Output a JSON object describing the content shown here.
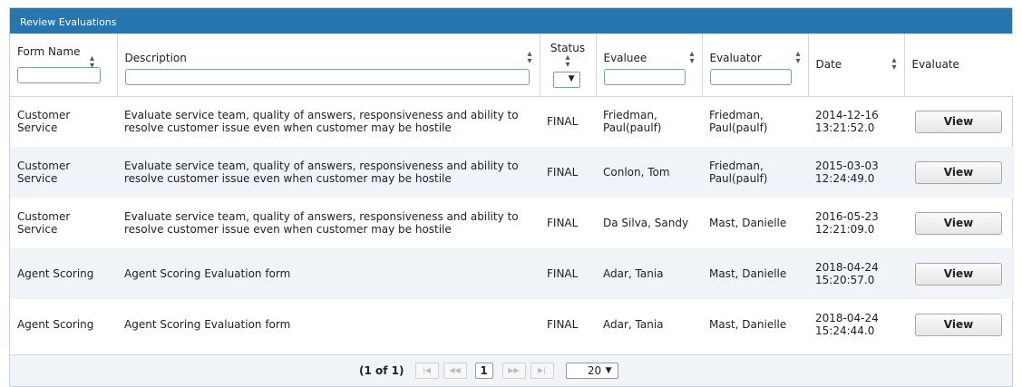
{
  "panel": {
    "title": "Review Evaluations"
  },
  "columns": {
    "form_name": "Form Name",
    "description": "Description",
    "status": "Status",
    "evaluee": "Evaluee",
    "evaluator": "Evaluator",
    "date": "Date",
    "evaluate": "Evaluate"
  },
  "icons": {
    "sort": "sort-up-down-icon",
    "dropdown": "caret-down-icon"
  },
  "rows": [
    {
      "form_name": "Customer Service",
      "description": "Evaluate service team, quality of answers, responsiveness and ability to resolve customer issue even when customer may be hostile",
      "status": "FINAL",
      "evaluee": "Friedman, Paul(paulf)",
      "evaluator": "Friedman, Paul(paulf)",
      "date": "2014-12-16 13:21:52.0",
      "action": "View"
    },
    {
      "form_name": "Customer Service",
      "description": "Evaluate service team, quality of answers, responsiveness and ability to resolve customer issue even when customer may be hostile",
      "status": "FINAL",
      "evaluee": "Conlon, Tom",
      "evaluator": "Friedman, Paul(paulf)",
      "date": "2015-03-03 12:24:49.0",
      "action": "View"
    },
    {
      "form_name": "Customer Service",
      "description": "Evaluate service team, quality of answers, responsiveness and ability to resolve customer issue even when customer may be hostile",
      "status": "FINAL",
      "evaluee": "Da Silva, Sandy",
      "evaluator": "Mast, Danielle",
      "date": "2016-05-23 12:21:09.0",
      "action": "View"
    },
    {
      "form_name": "Agent Scoring",
      "description": "Agent Scoring Evaluation form",
      "status": "FINAL",
      "evaluee": "Adar, Tania",
      "evaluator": "Mast, Danielle",
      "date": "2018-04-24 15:20:57.0",
      "action": "View"
    },
    {
      "form_name": "Agent Scoring",
      "description": "Agent Scoring Evaluation form",
      "status": "FINAL",
      "evaluee": "Adar, Tania",
      "evaluator": "Mast, Danielle",
      "date": "2018-04-24 15:24:44.0",
      "action": "View"
    }
  ],
  "paginator": {
    "status": "(1 of 1)",
    "first": "|◀",
    "prev": "◀◀",
    "current_page": "1",
    "next": "▶▶",
    "last": "▶|",
    "rows_per_page": "20"
  },
  "colors": {
    "header_bar": "#2876b0",
    "alt_row": "#f0f4f8"
  }
}
